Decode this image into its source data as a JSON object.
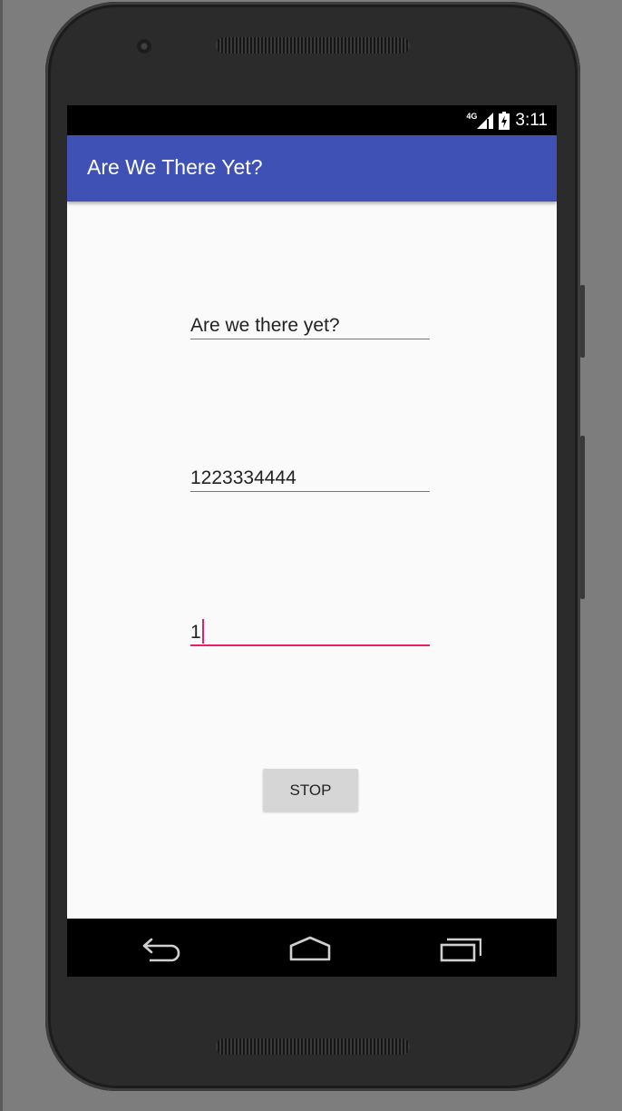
{
  "status_bar": {
    "network": "4G",
    "time": "3:11"
  },
  "app_bar": {
    "title": "Are We There Yet?",
    "color": "#3f51b5"
  },
  "form": {
    "message_value": "Are we there yet?",
    "phone_value": "1223334444",
    "minutes_value": "1",
    "stop_label": "STOP",
    "focus_color": "#e91e63"
  },
  "nav_bar": {
    "icons": [
      "back-icon",
      "home-icon",
      "recents-icon"
    ]
  }
}
